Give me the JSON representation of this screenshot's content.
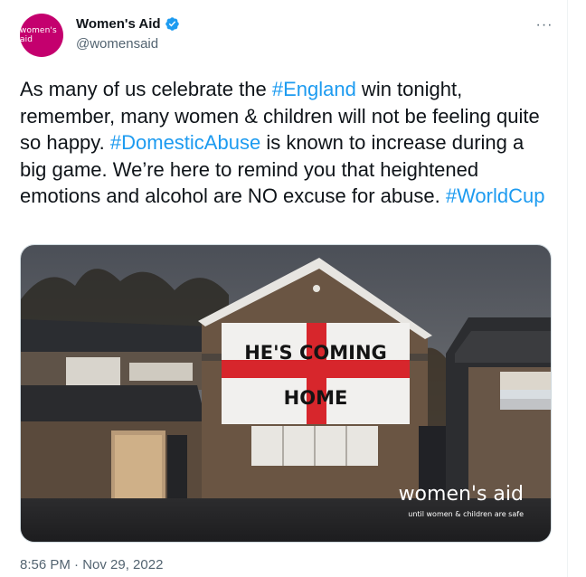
{
  "author": {
    "avatar_text": "women's aid",
    "display_name": "Women's Aid",
    "handle": "@womensaid",
    "verified_icon": "verified-badge-icon",
    "avatar_color": "#c4006e"
  },
  "tweet": {
    "text_parts": [
      {
        "t": "As many of us celebrate the ",
        "tag": false
      },
      {
        "t": "#England",
        "tag": true
      },
      {
        "t": " win tonight, remember, many women & children will not be feeling quite so happy. ",
        "tag": false
      },
      {
        "t": "#DomesticAbuse",
        "tag": true
      },
      {
        "t": " is known to increase during a big game. We’re here to remind you that heightened emotions and alcohol are NO excuse for abuse. ",
        "tag": false
      },
      {
        "t": "#WorldCup",
        "tag": true
      }
    ],
    "hashtag_color": "#1d9bf0"
  },
  "media": {
    "flag_line1": "HE'S COMING",
    "flag_line2": "HOME",
    "watermark_brand": "women's aid",
    "watermark_tagline": "until women & children are safe"
  },
  "meta": {
    "timestamp": "8:56 PM · Nov 29, 2022",
    "more_icon": "more-options-icon"
  }
}
